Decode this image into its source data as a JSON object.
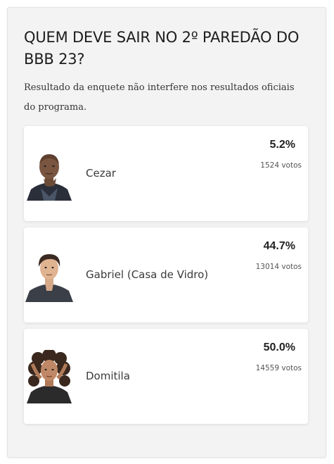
{
  "poll": {
    "title": "QUEM DEVE SAIR NO 2º PAREDÃO DO BBB 23?",
    "subtitle": "Resultado da enquete não interfere nos resultados oficiais do programa.",
    "options": [
      {
        "name": "Cezar",
        "percent": "5.2%",
        "votes": "1524 votos",
        "photo": "person-portrait-bald"
      },
      {
        "name": "Gabriel (Casa de Vidro)",
        "percent": "44.7%",
        "votes": "13014 votos",
        "photo": "person-portrait-short-hair"
      },
      {
        "name": "Domitila",
        "percent": "50.0%",
        "votes": "14559 votos",
        "photo": "person-portrait-curly-hair"
      }
    ]
  }
}
